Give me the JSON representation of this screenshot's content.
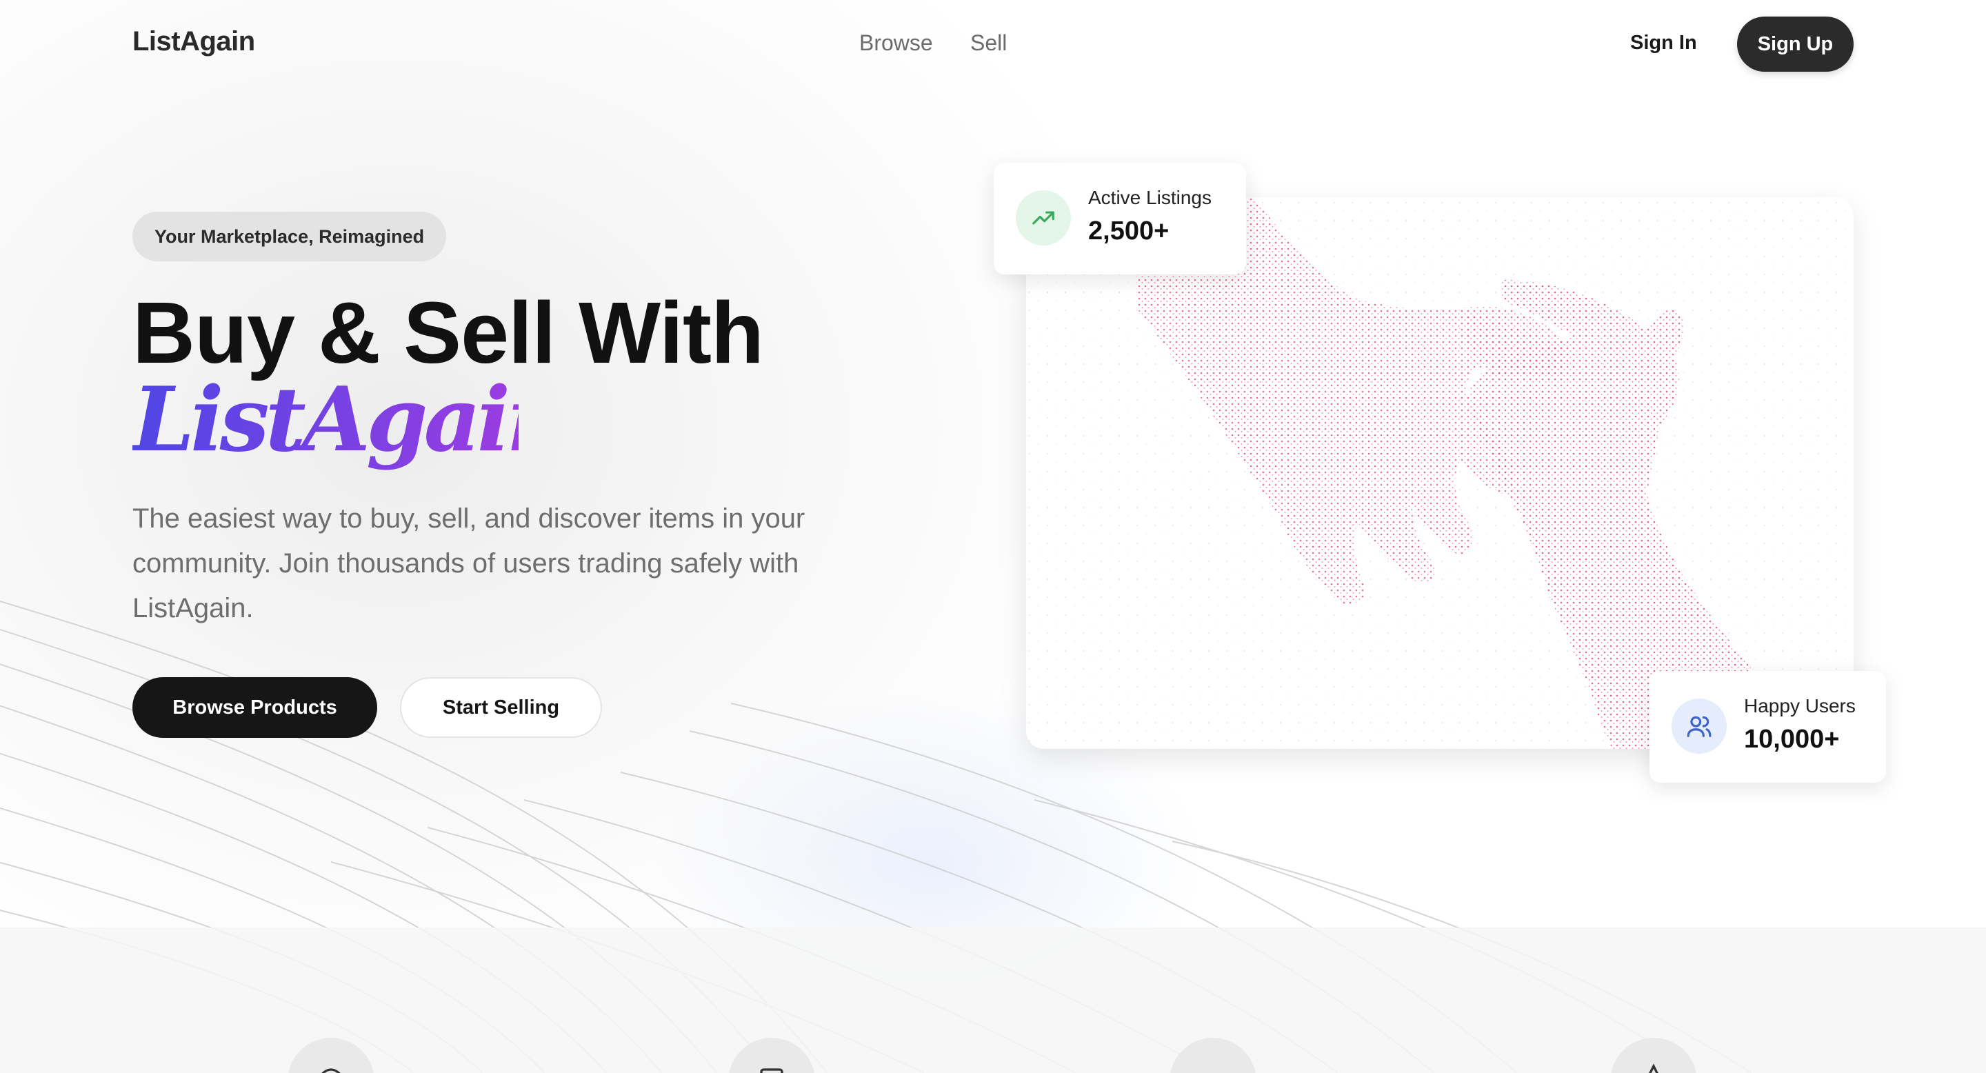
{
  "nav": {
    "logo": "ListAgain",
    "links": [
      {
        "label": "Browse"
      },
      {
        "label": "Sell"
      }
    ],
    "sign_in": "Sign In",
    "sign_up": "Sign Up"
  },
  "hero": {
    "badge": "Your Marketplace, Reimagined",
    "headline": "Buy & Sell With",
    "brand_script": "ListAgain",
    "subtext": "The easiest way to buy, sell, and discover items in your community. Join thousands of users trading safely with ListAgain.",
    "primary_button": "Browse Products",
    "secondary_button": "Start Selling"
  },
  "stats": {
    "listings": {
      "label": "Active Listings",
      "value": "2,500+",
      "icon": "trending-up-icon",
      "color": "#3aa85a"
    },
    "users": {
      "label": "Happy Users",
      "value": "10,000+",
      "icon": "users-icon",
      "color": "#3b63c9"
    }
  },
  "features": [
    {
      "icon": "feature-icon-1"
    },
    {
      "icon": "feature-icon-2"
    },
    {
      "icon": "feature-icon-3"
    },
    {
      "icon": "feature-icon-4"
    }
  ],
  "colors": {
    "brand_gradient_start": "#4f46e5",
    "brand_gradient_end": "#a43be0",
    "primary_button": "#161616",
    "hands_particles": "#e8577e"
  }
}
